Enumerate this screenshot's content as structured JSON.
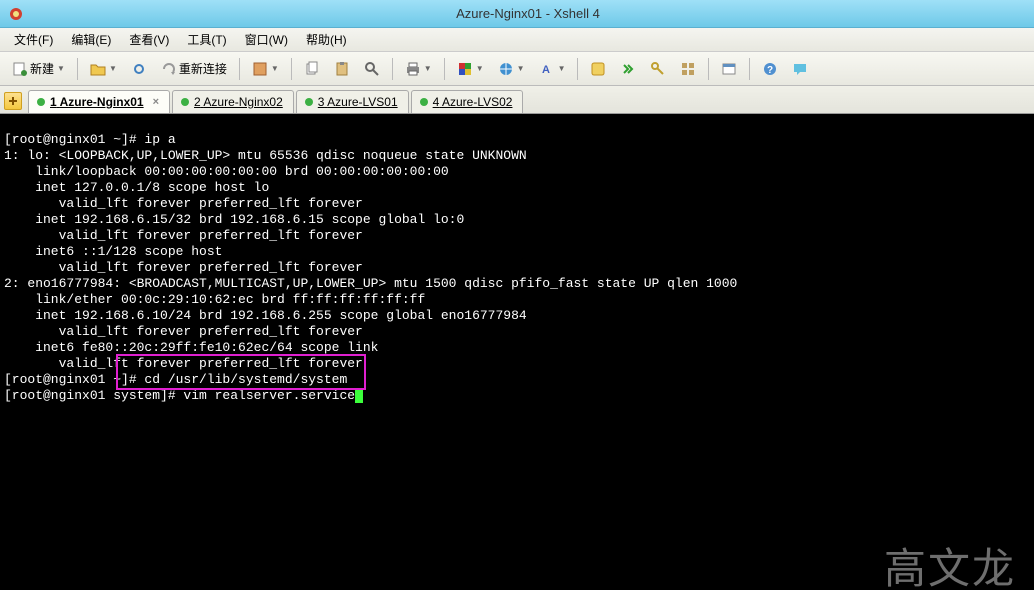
{
  "window": {
    "title": "Azure-Nginx01 - Xshell 4"
  },
  "menu": {
    "file": "文件(F)",
    "edit": "编辑(E)",
    "view": "查看(V)",
    "tools": "工具(T)",
    "window": "窗口(W)",
    "help": "帮助(H)"
  },
  "toolbar": {
    "new_label": "新建",
    "reconnect_label": "重新连接"
  },
  "tabs": [
    {
      "index": "1",
      "label": "Azure-Nginx01",
      "active": true,
      "closable": true
    },
    {
      "index": "2",
      "label": "Azure-Nginx02",
      "active": false,
      "closable": false
    },
    {
      "index": "3",
      "label": "Azure-LVS01",
      "active": false,
      "closable": false
    },
    {
      "index": "4",
      "label": "Azure-LVS02",
      "active": false,
      "closable": false
    }
  ],
  "terminal": {
    "lines": [
      "[root@nginx01 ~]# ip a",
      "1: lo: <LOOPBACK,UP,LOWER_UP> mtu 65536 qdisc noqueue state UNKNOWN",
      "    link/loopback 00:00:00:00:00:00 brd 00:00:00:00:00:00",
      "    inet 127.0.0.1/8 scope host lo",
      "       valid_lft forever preferred_lft forever",
      "    inet 192.168.6.15/32 brd 192.168.6.15 scope global lo:0",
      "       valid_lft forever preferred_lft forever",
      "    inet6 ::1/128 scope host",
      "       valid_lft forever preferred_lft forever",
      "2: eno16777984: <BROADCAST,MULTICAST,UP,LOWER_UP> mtu 1500 qdisc pfifo_fast state UP qlen 1000",
      "    link/ether 00:0c:29:10:62:ec brd ff:ff:ff:ff:ff:ff",
      "    inet 192.168.6.10/24 brd 192.168.6.255 scope global eno16777984",
      "       valid_lft forever preferred_lft forever",
      "    inet6 fe80::20c:29ff:fe10:62ec/64 scope link",
      "       valid_lft forever preferred_lft forever",
      "[root@nginx01 ~]# cd /usr/lib/systemd/system",
      "[root@nginx01 system]# vim realserver.service"
    ],
    "watermark": "高文龙"
  }
}
